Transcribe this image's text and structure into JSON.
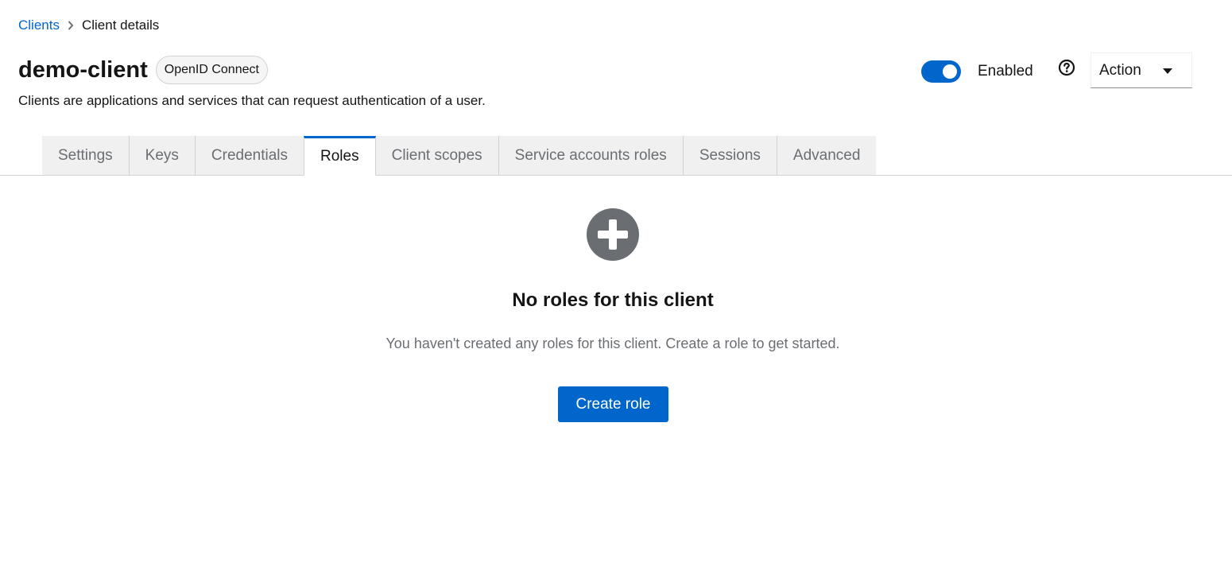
{
  "breadcrumb": {
    "parent": "Clients",
    "current": "Client details"
  },
  "header": {
    "title": "demo-client",
    "protocol_badge": "OpenID Connect",
    "subtitle": "Clients are applications and services that can request authentication of a user.",
    "enabled_label": "Enabled",
    "enabled": true,
    "action_label": "Action"
  },
  "tabs": [
    {
      "label": "Settings",
      "active": false
    },
    {
      "label": "Keys",
      "active": false
    },
    {
      "label": "Credentials",
      "active": false
    },
    {
      "label": "Roles",
      "active": true
    },
    {
      "label": "Client scopes",
      "active": false
    },
    {
      "label": "Service accounts roles",
      "active": false
    },
    {
      "label": "Sessions",
      "active": false
    },
    {
      "label": "Advanced",
      "active": false
    }
  ],
  "empty_state": {
    "icon": "plus-circle-icon",
    "title": "No roles for this client",
    "body": "You haven't created any roles for this client. Create a role to get started.",
    "button_label": "Create role"
  },
  "colors": {
    "accent": "#0066cc",
    "icon_gray": "#6a6e73",
    "tab_bg": "#f0f0f0"
  }
}
